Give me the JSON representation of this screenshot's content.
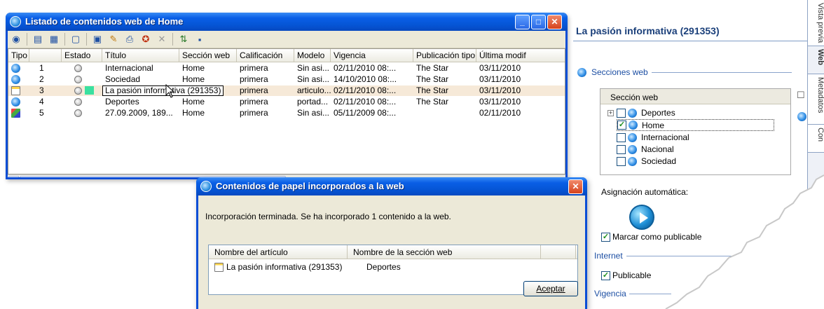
{
  "listado": {
    "title": "Listado de contenidos web de Home",
    "columns": [
      "Tipo",
      "Estado",
      "Título",
      "Sección web",
      "Calificación",
      "Modelo",
      "Vigencia",
      "Publicación tipo",
      "Última modif"
    ],
    "rows": [
      {
        "num": "1",
        "titulo": "Internacional",
        "seccion": "Home",
        "calificacion": "primera",
        "modelo": "Sin asi...",
        "vigencia": "02/11/2010 08:...",
        "pub": "The Star",
        "ultima": "03/11/2010"
      },
      {
        "num": "2",
        "titulo": "Sociedad",
        "seccion": "Home",
        "calificacion": "primera",
        "modelo": "Sin asi...",
        "vigencia": "14/10/2010 08:...",
        "pub": "The Star",
        "ultima": "03/11/2010"
      },
      {
        "num": "3",
        "titulo": "La pasión informativa (291353)",
        "seccion": "",
        "calificacion": "primera",
        "modelo": "articulo...",
        "vigencia": "02/11/2010 08:...",
        "pub": "The Star",
        "ultima": "03/11/2010"
      },
      {
        "num": "4",
        "titulo": "Deportes",
        "seccion": "Home",
        "calificacion": "primera",
        "modelo": "portad...",
        "vigencia": "02/11/2010 08:...",
        "pub": "The Star",
        "ultima": "03/11/2010"
      },
      {
        "num": "5",
        "titulo": "27.09.2009, 189...",
        "seccion": "Home",
        "calificacion": "primera",
        "modelo": "Sin asi...",
        "vigencia": "05/11/2009 08:...",
        "pub": "",
        "ultima": "02/11/2010"
      }
    ]
  },
  "panel": {
    "title": "La pasión informativa (291353)",
    "secciones_label": "Secciones web",
    "tree_header": "Sección web",
    "tree_items": [
      {
        "label": "Deportes",
        "checked": false
      },
      {
        "label": "Home",
        "checked": true
      },
      {
        "label": "Internacional",
        "checked": false
      },
      {
        "label": "Nacional",
        "checked": false
      },
      {
        "label": "Sociedad",
        "checked": false
      }
    ],
    "asignacion_label": "Asignación automática:",
    "marcar_label": "Marcar como publicable",
    "internet_label": "Internet",
    "publicable_label": "Publicable",
    "vigencia_label": "Vigencia",
    "tabs": [
      "Vista previa",
      "Web",
      "Metadatos",
      "Con"
    ]
  },
  "dialog": {
    "title": "Contenidos de papel incorporados a la web",
    "message": "Incorporación terminada. Se ha incorporado 1 contenido a la web.",
    "col_articulo": "Nombre del artículo",
    "col_seccion": "Nombre de la sección web",
    "row_articulo": "La pasión informativa (291353)",
    "row_seccion": "Deportes",
    "ok_label": "Aceptar"
  },
  "colors": {
    "xp_blue": "#0a4ed6",
    "selected_row": "#f6e9d8",
    "accent_green": "#3ae0a0"
  }
}
